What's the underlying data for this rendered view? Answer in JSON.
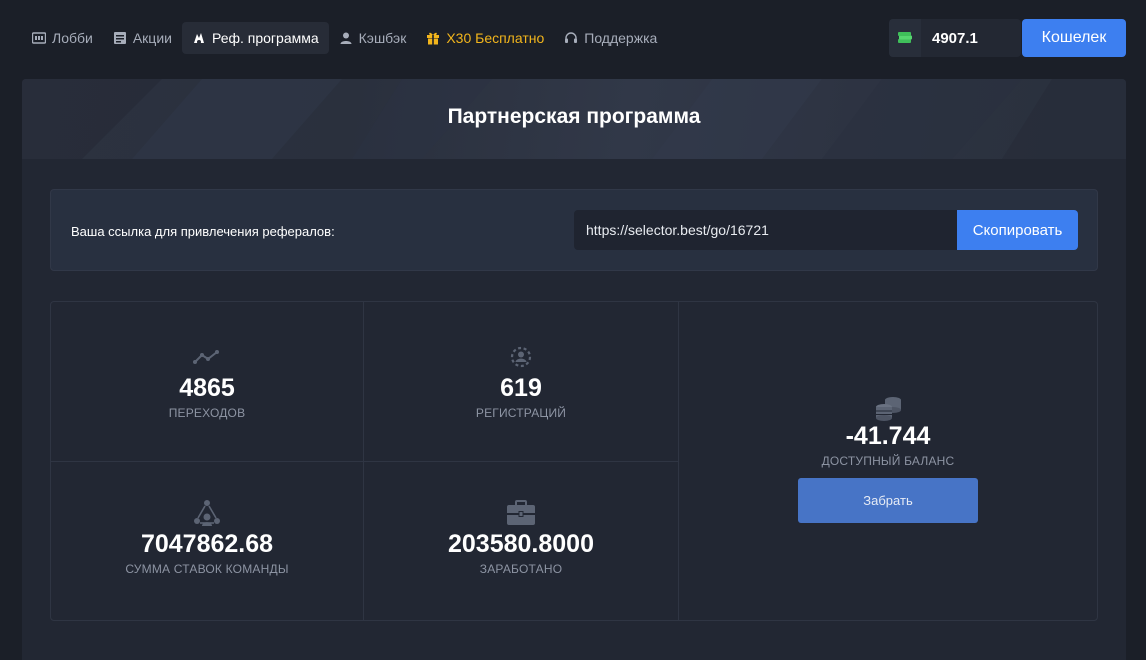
{
  "nav": {
    "items": [
      {
        "label": "Лобби",
        "icon": "lobby-icon"
      },
      {
        "label": "Акции",
        "icon": "promotions-icon"
      },
      {
        "label": "Реф. программа",
        "icon": "referral-icon"
      },
      {
        "label": "Кэшбэк",
        "icon": "user-icon"
      },
      {
        "label": "X30 Бесплатно",
        "icon": "gift-icon"
      },
      {
        "label": "Поддержка",
        "icon": "headset-icon"
      }
    ],
    "active_index": 2
  },
  "header": {
    "balance": "4907.1",
    "wallet_label": "Кошелек"
  },
  "banner": {
    "title": "Партнерская программа"
  },
  "referral": {
    "label": "Ваша ссылка для привлечения рефералов:",
    "link": "https://selector.best/go/16721",
    "copy_label": "Скопировать"
  },
  "stats": {
    "clicks": {
      "value": "4865",
      "caption": "ПЕРЕХОДОВ",
      "icon": "trend-icon"
    },
    "registrations": {
      "value": "619",
      "caption": "РЕГИСТРАЦИЙ",
      "icon": "user-gear-icon"
    },
    "team_bets": {
      "value": "7047862.68",
      "caption": "СУММА СТАВОК КОМАНДЫ",
      "icon": "team-icon"
    },
    "earned": {
      "value": "203580.8000",
      "caption": "ЗАРАБОТАНО",
      "icon": "briefcase-icon"
    },
    "balance": {
      "value": "-41.744",
      "caption": "ДОСТУПНЫЙ БАЛАНС",
      "icon": "coins-icon",
      "button_label": "Забрать"
    }
  },
  "colors": {
    "accent": "#3d7ff0",
    "promo": "#f2b51c",
    "background": "#1b1f28",
    "panel": "#222733"
  }
}
